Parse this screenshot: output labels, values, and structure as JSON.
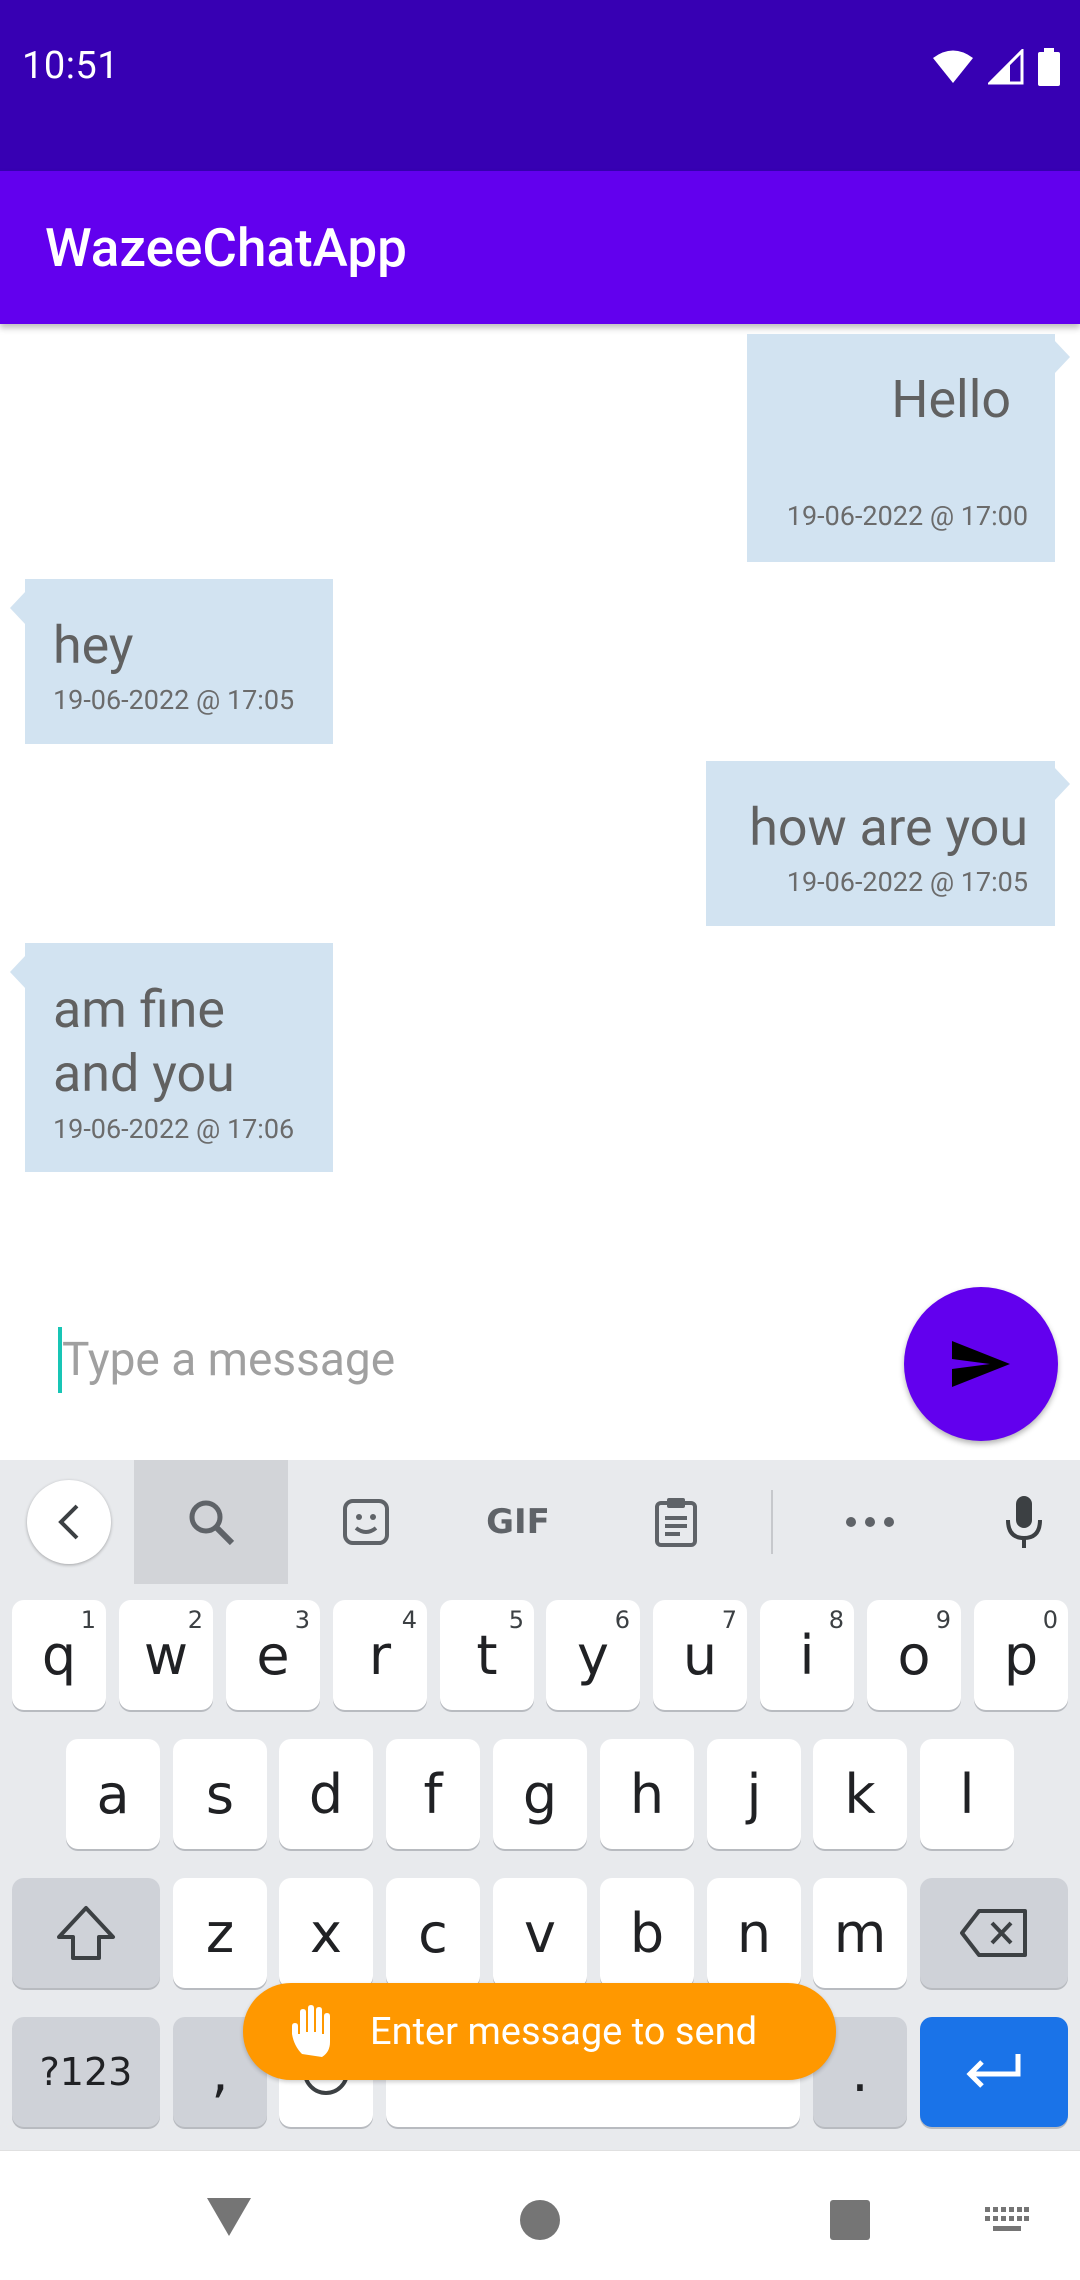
{
  "status_bar": {
    "time": "10:51"
  },
  "app": {
    "title": "WazeeChatApp"
  },
  "messages": [
    {
      "text": "Hello",
      "timestamp": "19-06-2022 @ 17:00",
      "direction": "sent"
    },
    {
      "text": "hey",
      "timestamp": "19-06-2022 @ 17:05",
      "direction": "received"
    },
    {
      "text": "how are you",
      "timestamp": "19-06-2022 @ 17:05",
      "direction": "sent"
    },
    {
      "text": "am fine\nand you",
      "timestamp": "19-06-2022 @ 17:06",
      "direction": "received"
    }
  ],
  "input": {
    "placeholder": "Type a message"
  },
  "keyboard": {
    "toolbar": [
      "back-icon",
      "search-icon",
      "sticker-icon",
      "gif-icon",
      "clipboard-icon",
      "more-icon",
      "mic-icon"
    ],
    "gif_label": "GIF",
    "row1": [
      "q",
      "w",
      "e",
      "r",
      "t",
      "y",
      "u",
      "i",
      "o",
      "p"
    ],
    "row1_hints": [
      "1",
      "2",
      "3",
      "4",
      "5",
      "6",
      "7",
      "8",
      "9",
      "0"
    ],
    "row2": [
      "a",
      "s",
      "d",
      "f",
      "g",
      "h",
      "j",
      "k",
      "l"
    ],
    "row3": [
      "z",
      "x",
      "c",
      "v",
      "b",
      "n",
      "m"
    ],
    "symbols_key": "?123",
    "comma_key": ",",
    "period_key": "."
  },
  "toast": {
    "text": "Enter message to send"
  },
  "colors": {
    "status_bar": "#3700b3",
    "app_bar": "#6200ee",
    "bubble": "#d2e3f1",
    "send_button": "#6200ee",
    "toast": "#ff9800",
    "enter_key": "#1a73e8"
  }
}
